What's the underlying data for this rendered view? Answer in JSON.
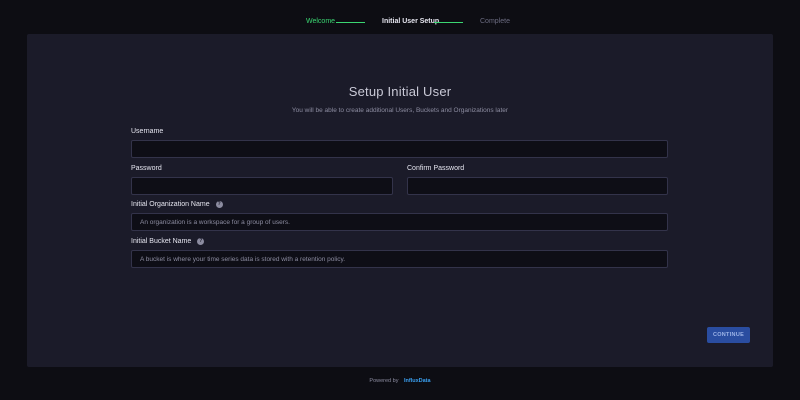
{
  "stepper": {
    "steps": [
      {
        "label": "Welcome",
        "state": "done"
      },
      {
        "label": "Initial User Setup",
        "state": "current"
      },
      {
        "label": "Complete",
        "state": "pending"
      }
    ]
  },
  "form": {
    "title": "Setup Initial User",
    "subtitle": "You will be able to create additional Users, Buckets and Organizations later",
    "username": {
      "label": "Username",
      "value": "",
      "placeholder": ""
    },
    "password": {
      "label": "Password",
      "value": "",
      "placeholder": ""
    },
    "confirm_password": {
      "label": "Confirm Password",
      "value": "",
      "placeholder": ""
    },
    "organization": {
      "label": "Initial Organization Name",
      "placeholder": "An organization is a workspace for a group of users.",
      "icon": "info-icon"
    },
    "bucket": {
      "label": "Initial Bucket Name",
      "placeholder": "A bucket is where your time series data is stored with a retention policy.",
      "icon": "info-icon"
    },
    "continue_label": "CONTINUE"
  },
  "footer": {
    "powered_by": "Powered by",
    "brand": "InfluxData"
  },
  "colors": {
    "background": "#0d0d13",
    "panel": "#1b1b29",
    "step_done": "#3bd672",
    "button": "#2a4da0",
    "brand": "#3a9fef"
  }
}
